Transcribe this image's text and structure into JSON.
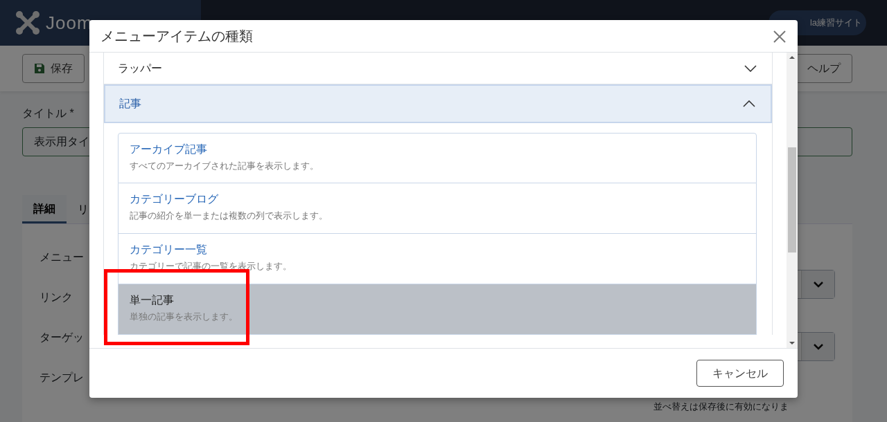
{
  "header": {
    "logo": "Joom",
    "user_menu": "la練習サイト"
  },
  "toolbar": [
    {
      "label": "保存",
      "kind": "save"
    },
    {
      "label": "ヘルプ",
      "kind": "help"
    }
  ],
  "form": {
    "title_label": "タイトル *",
    "title_value": "表示用タイ",
    "tabs": [
      {
        "label": "詳細",
        "selected": true
      },
      {
        "label": "リ",
        "selected": false
      }
    ],
    "field_labels": [
      "メニュー",
      "リンク",
      "ターゲッ",
      "テンプレ"
    ],
    "note": "並べ替えは保存後に有効になりま"
  },
  "modal": {
    "title": "メニューアイテムの種類",
    "groups": [
      {
        "label": "ラッパー",
        "expanded": false
      },
      {
        "label": "記事",
        "expanded": true,
        "items": [
          {
            "title": "アーカイブ記事",
            "description": "すべてのアーカイブされた記事を表示します。",
            "selected": false,
            "highlighted": false
          },
          {
            "title": "カテゴリーブログ",
            "description": "記事の紹介を単一または複数の列で表示します。",
            "selected": false,
            "highlighted": false
          },
          {
            "title": "カテゴリー一覧",
            "description": "カテゴリーで記事の一覧を表示します。",
            "selected": false,
            "highlighted": false
          },
          {
            "title": "単一記事",
            "description": "単独の記事を表示します。",
            "selected": true,
            "highlighted": true
          }
        ]
      }
    ],
    "buttons": [
      "キャンセル"
    ]
  }
}
